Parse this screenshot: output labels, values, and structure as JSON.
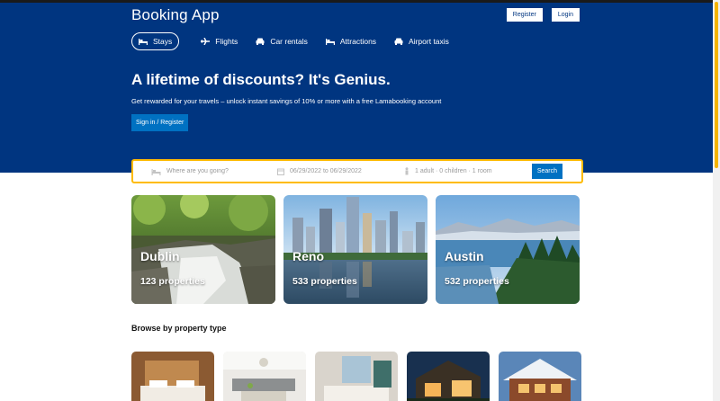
{
  "header": {
    "logo": "Booking App",
    "register_label": "Register",
    "login_label": "Login",
    "bg_color": "#003580"
  },
  "nav": {
    "items": [
      {
        "label": "Stays",
        "icon": "bed-icon",
        "active": true
      },
      {
        "label": "Flights",
        "icon": "plane-icon",
        "active": false
      },
      {
        "label": "Car rentals",
        "icon": "car-icon",
        "active": false
      },
      {
        "label": "Attractions",
        "icon": "bed-icon",
        "active": false
      },
      {
        "label": "Airport taxis",
        "icon": "taxi-icon",
        "active": false
      }
    ]
  },
  "hero": {
    "title": "A lifetime of discounts? It's Genius.",
    "description": "Get rewarded for your travels – unlock instant savings of 10% or more with a free Lamabooking account",
    "button_label": "Sign in / Register"
  },
  "search": {
    "destination_placeholder": "Where are you going?",
    "dates": "06/29/2022 to 06/29/2022",
    "guests": "1 adult · 0 children · 1 room",
    "button_label": "Search",
    "border_color": "#febb02"
  },
  "featured": [
    {
      "city": "Dublin",
      "properties": "123 properties"
    },
    {
      "city": "Reno",
      "properties": "533 properties"
    },
    {
      "city": "Austin",
      "properties": "532 properties"
    }
  ],
  "browse": {
    "title": "Browse by property type",
    "types_count_shown": 5
  }
}
